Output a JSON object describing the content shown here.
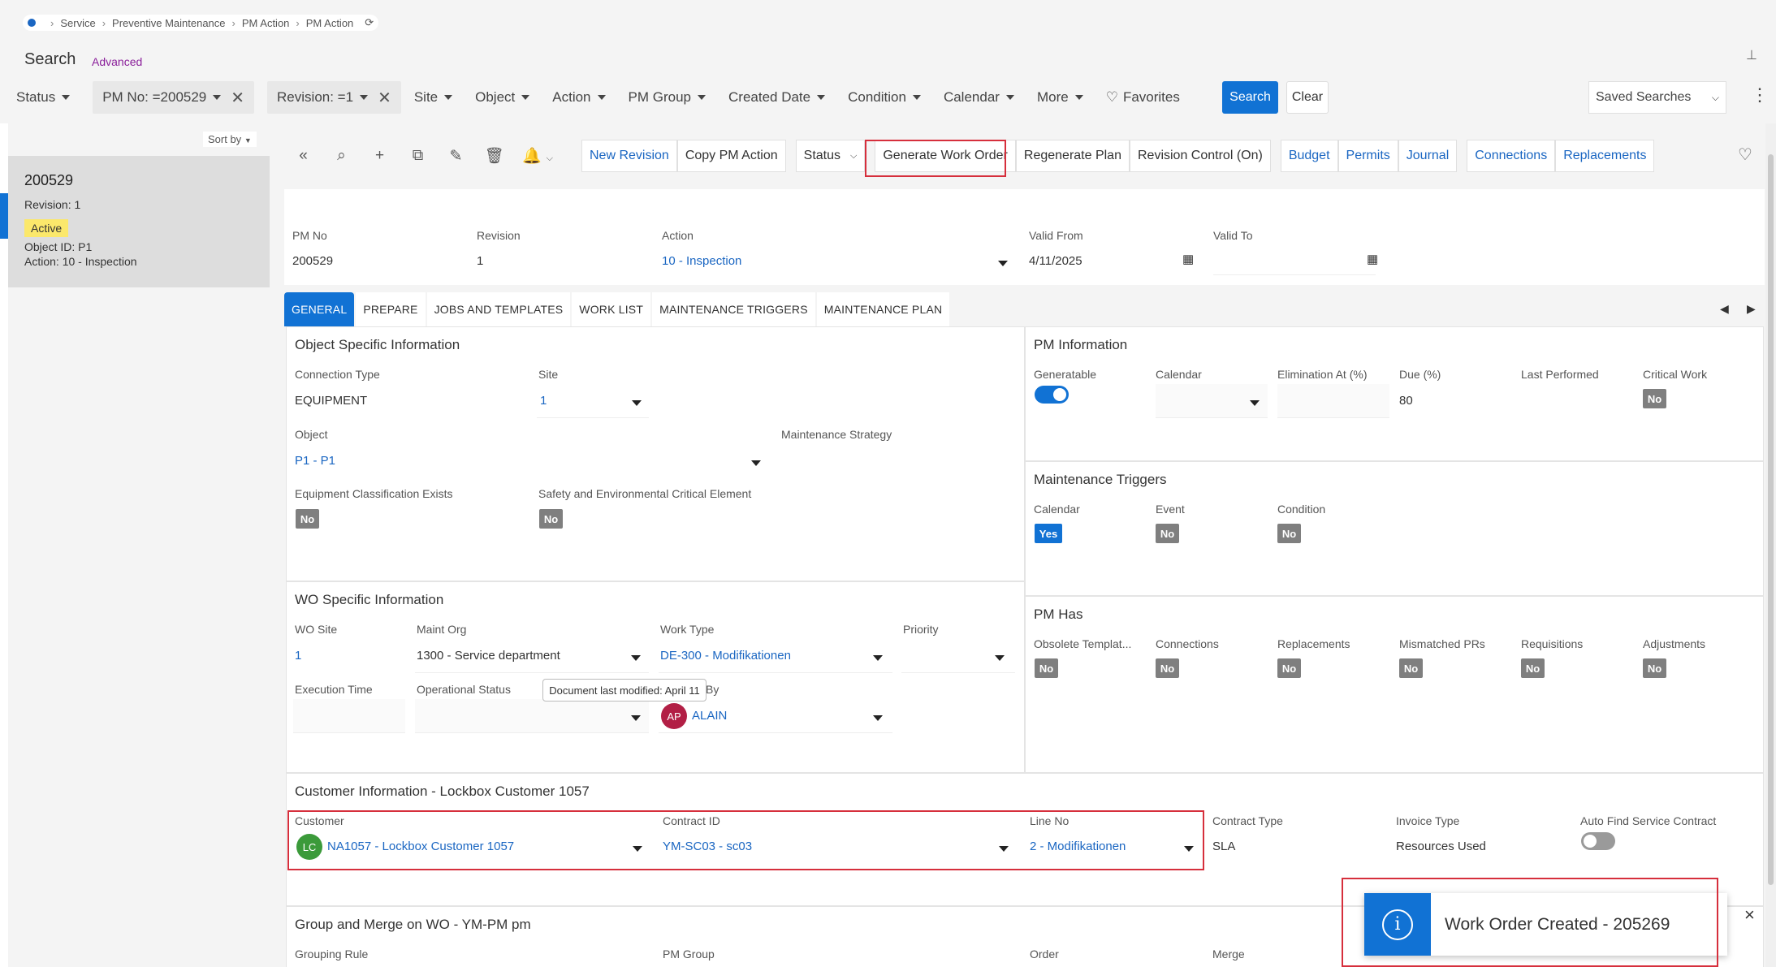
{
  "breadcrumb": [
    "Service",
    "Preventive Maintenance",
    "PM Action",
    "PM Action"
  ],
  "search": {
    "title": "Search",
    "advanced": "Advanced",
    "search_btn": "Search",
    "clear_btn": "Clear",
    "saved_searches": "Saved Searches"
  },
  "filters": {
    "status": "Status",
    "pm_no": "PM No: =200529",
    "revision": "Revision: =1",
    "site": "Site",
    "object": "Object",
    "action": "Action",
    "pm_group": "PM Group",
    "created_date": "Created Date",
    "condition": "Condition",
    "calendar": "Calendar",
    "more": "More",
    "favorites": "Favorites"
  },
  "list": {
    "sort_by": "Sort by",
    "item": {
      "title": "200529",
      "revision": "Revision:  1",
      "status": "Active",
      "object": "Object ID:  P1",
      "action": "Action:  10 - Inspection"
    }
  },
  "toolbar": {
    "new_revision": "New Revision",
    "copy_pm": "Copy PM Action",
    "status": "Status",
    "generate_wo": "Generate Work Order",
    "regenerate": "Regenerate Plan",
    "revision_control": "Revision Control (On)",
    "budget": "Budget",
    "permits": "Permits",
    "journal": "Journal",
    "connections": "Connections",
    "replacements": "Replacements"
  },
  "header": {
    "pm_no_label": "PM No",
    "pm_no": "200529",
    "revision_label": "Revision",
    "revision": "1",
    "action_label": "Action",
    "action": "10 - Inspection",
    "valid_from_label": "Valid From",
    "valid_from": "4/11/2025",
    "valid_to_label": "Valid To"
  },
  "tabs": [
    "GENERAL",
    "PREPARE",
    "JOBS AND TEMPLATES",
    "WORK LIST",
    "MAINTENANCE TRIGGERS",
    "MAINTENANCE PLAN"
  ],
  "osi": {
    "title": "Object Specific Information",
    "conn_type_label": "Connection Type",
    "conn_type": "EQUIPMENT",
    "site_label": "Site",
    "site": "1",
    "object_label": "Object",
    "object": "P1 - P1",
    "strategy_label": "Maintenance Strategy",
    "eq_class_label": "Equipment Classification Exists",
    "eq_class": "No",
    "safety_label": "Safety and Environmental Critical Element",
    "safety": "No"
  },
  "pmi": {
    "title": "PM Information",
    "generatable_label": "Generatable",
    "calendar_label": "Calendar",
    "elimination_label": "Elimination At (%)",
    "due_label": "Due (%)",
    "due": "80",
    "last_label": "Last Performed",
    "critical_label": "Critical Work",
    "critical": "No"
  },
  "mt": {
    "title": "Maintenance Triggers",
    "calendar_label": "Calendar",
    "calendar": "Yes",
    "event_label": "Event",
    "event": "No",
    "condition_label": "Condition",
    "condition": "No"
  },
  "wo": {
    "title": "WO Specific Information",
    "site_label": "WO Site",
    "site": "1",
    "org_label": "Maint Org",
    "org": "1300 - Service department",
    "type_label": "Work Type",
    "type": "DE-300 - Modifikationen",
    "priority_label": "Priority",
    "exec_label": "Execution Time",
    "op_status_label": "Operational Status",
    "by_suffix": "By",
    "by_initials": "AP",
    "by": "ALAIN",
    "tooltip": "Document last modified: April 11"
  },
  "pmhas": {
    "title": "PM Has",
    "obsolete_label": "Obsolete Templat...",
    "obsolete": "No",
    "connections_label": "Connections",
    "connections": "No",
    "replacements_label": "Replacements",
    "replacements": "No",
    "mismatched_label": "Mismatched PRs",
    "mismatched": "No",
    "requisitions_label": "Requisitions",
    "requisitions": "No",
    "adjustments_label": "Adjustments",
    "adjustments": "No"
  },
  "cust": {
    "title": "Customer Information - Lockbox Customer 1057",
    "customer_label": "Customer",
    "customer_initials": "LC",
    "customer": "NA1057 - Lockbox Customer 1057",
    "contract_label": "Contract ID",
    "contract": "YM-SC03 - sc03",
    "line_label": "Line No",
    "line": "2 - Modifikationen",
    "ctype_label": "Contract Type",
    "ctype": "SLA",
    "invoice_label": "Invoice Type",
    "invoice": "Resources Used",
    "auto_label": "Auto Find Service Contract"
  },
  "group": {
    "title": "Group and Merge on WO - YM-PM pm",
    "rule_label": "Grouping Rule",
    "pmgroup_label": "PM Group",
    "order_label": "Order",
    "merge_label": "Merge"
  },
  "toast": {
    "message": "Work Order Created - 205269",
    "close": "×"
  },
  "colors": {
    "accent": "#1172d4",
    "highlight": "#d62f3c",
    "badge_active": "#fbe86b"
  }
}
